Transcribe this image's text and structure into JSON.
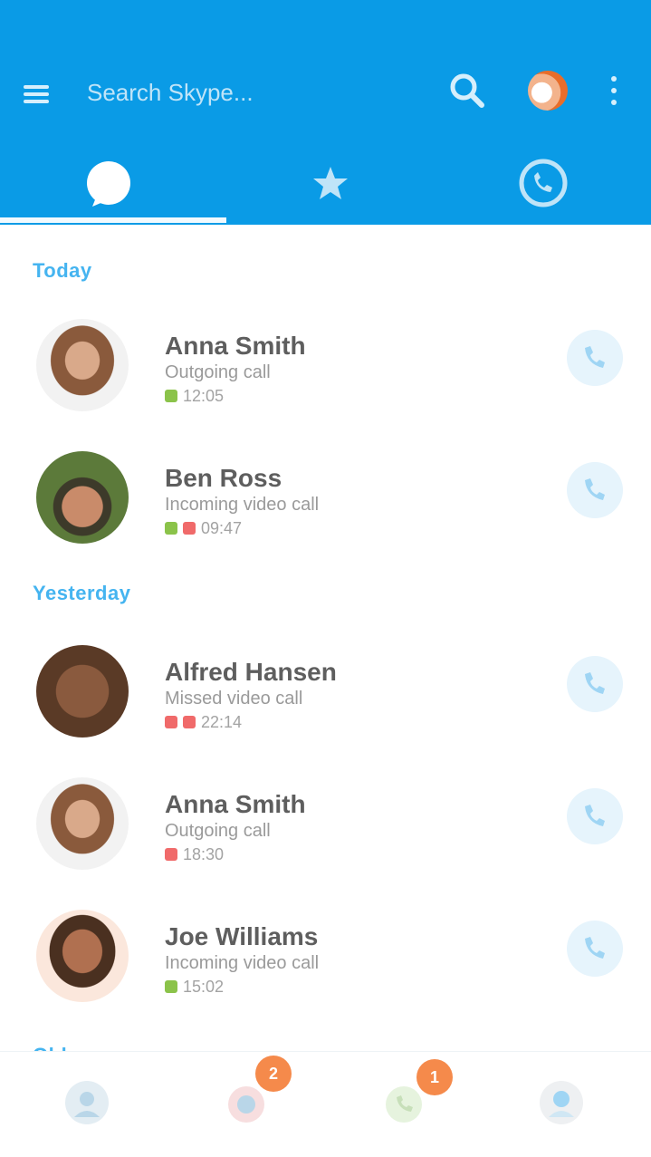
{
  "header": {
    "search_text": "Search Skype...",
    "colors": {
      "appbar": "#0a9be6",
      "accent": "#45b4f0",
      "badge": "#f58a4b"
    }
  },
  "tabs": [
    {
      "icon": "chat-bubble-icon",
      "active": true
    },
    {
      "icon": "star-icon",
      "active": false
    },
    {
      "icon": "phone-icon",
      "active": false
    }
  ],
  "sections": [
    {
      "title": "Today"
    },
    {
      "title": "Yesterday"
    },
    {
      "title": "Older"
    }
  ],
  "calls": [
    {
      "name": "Anna Smith",
      "detail": "Outgoing call",
      "meta": "12:05",
      "status_color": "#8bc34a",
      "avatar": "woman-long-hair"
    },
    {
      "name": "Ben Ross",
      "detail": "Incoming video call",
      "meta": "09:47",
      "status_color": "#f06a6a",
      "avatar": "man-outdoor"
    },
    {
      "name": "Alfred Hansen",
      "detail": "Missed video call",
      "meta": "22:14",
      "status_color": "#f06a6a",
      "avatar": "man-dark"
    },
    {
      "name": "Anna Smith",
      "detail": "Outgoing call",
      "meta": "18:30",
      "status_color": "#f06a6a",
      "avatar": "woman-long-hair"
    },
    {
      "name": "Joe Williams",
      "detail": "Incoming video call",
      "meta": "15:02",
      "status_color": "#8bc34a",
      "avatar": "man-beard"
    }
  ],
  "bottom_nav": [
    {
      "icon": "contacts-icon",
      "badge": ""
    },
    {
      "icon": "chats-icon",
      "badge": "2"
    },
    {
      "icon": "calls-icon",
      "badge": "1"
    },
    {
      "icon": "profile-icon",
      "badge": ""
    }
  ]
}
